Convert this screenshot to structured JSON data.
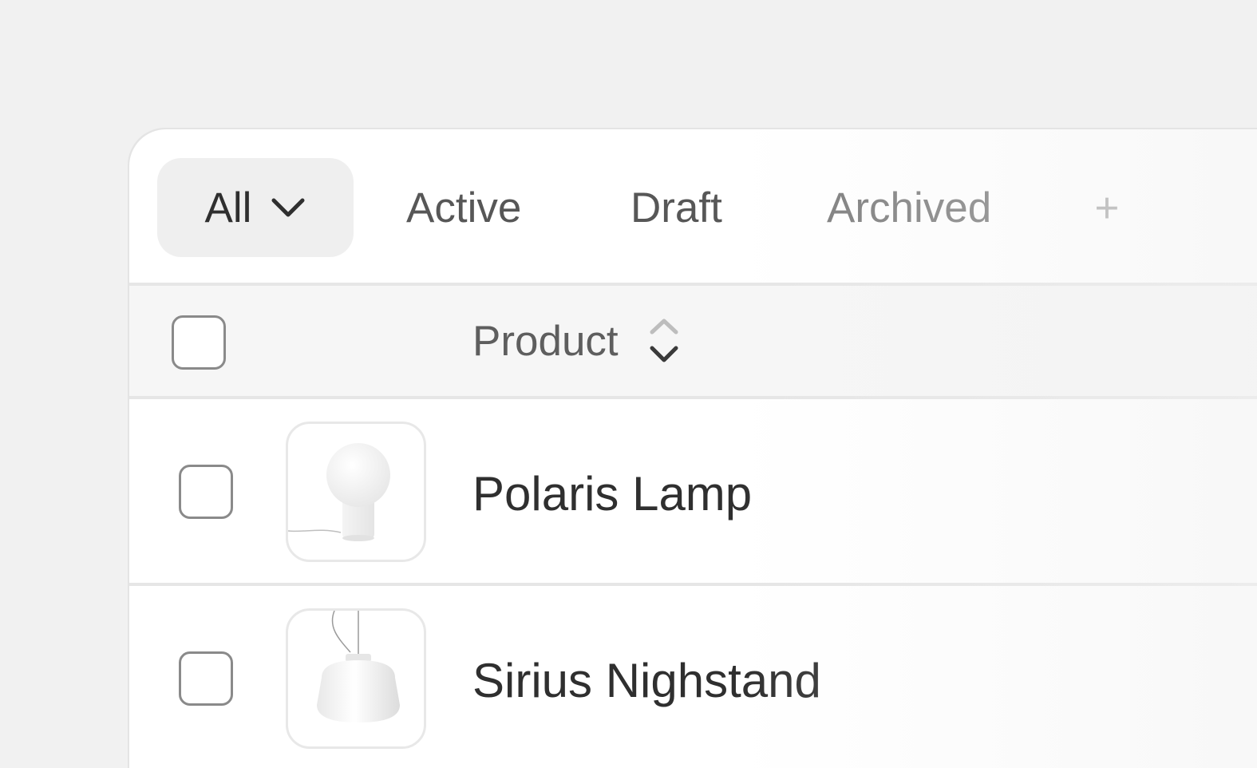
{
  "tabs": {
    "all_label": "All",
    "active_label": "Active",
    "draft_label": "Draft",
    "archived_label": "Archived",
    "add_label": "+"
  },
  "table": {
    "header": {
      "product_label": "Product"
    },
    "rows": [
      {
        "name": "Polaris Lamp",
        "thumbnail_icon": "table-lamp-icon"
      },
      {
        "name": "Sirius Nighstand",
        "thumbnail_icon": "pendant-lamp-icon"
      }
    ]
  }
}
